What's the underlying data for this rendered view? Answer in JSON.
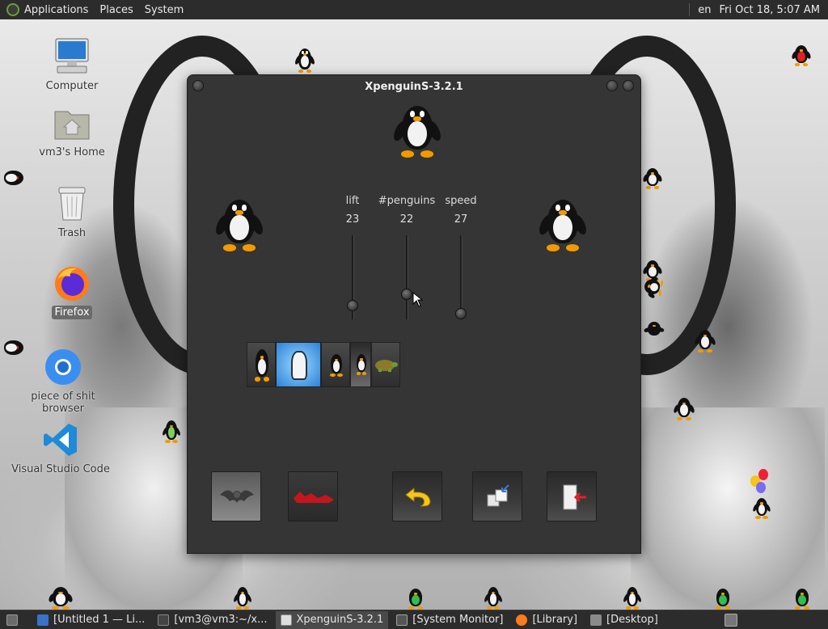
{
  "top_panel": {
    "menus": [
      "Applications",
      "Places",
      "System"
    ],
    "keyboard_layout": "en",
    "clock": "Fri Oct 18,  5:07 AM"
  },
  "desktop_icons": [
    {
      "label": "Computer",
      "icon": "computer-icon"
    },
    {
      "label": "vm3's Home",
      "icon": "home-folder-icon"
    },
    {
      "label": "Trash",
      "icon": "trash-icon"
    },
    {
      "label": "Firefox",
      "icon": "firefox-icon"
    },
    {
      "label": "piece of shit browser",
      "icon": "browser-icon"
    },
    {
      "label": "Visual Studio Code",
      "icon": "vscode-icon"
    }
  ],
  "window": {
    "title": "XpenguinS-3.2.1",
    "sliders": [
      {
        "label": "lift",
        "value": "23"
      },
      {
        "label": "#penguins",
        "value": "22"
      },
      {
        "label": "speed",
        "value": "27"
      }
    ],
    "themes": [
      "penguins-theme",
      "wizard-theme",
      "small-penguin-theme",
      "selected-penguin-theme",
      "turtle-theme"
    ],
    "bottom_buttons": [
      "bat-button",
      "lemming-button",
      "undo-button",
      "windows-button",
      "exit-button"
    ]
  },
  "taskbar": {
    "tasks": [
      {
        "label": "[Untitled 1 — Li...",
        "icon": "writer-icon"
      },
      {
        "label": "[vm3@vm3:~/x...",
        "icon": "terminal-icon"
      },
      {
        "label": "XpenguinS-3.2.1",
        "icon": "window-icon"
      },
      {
        "label": "[System Monitor]",
        "icon": "monitor-icon"
      },
      {
        "label": "[Library]",
        "icon": "firefox-icon"
      },
      {
        "label": "[Desktop]",
        "icon": "folder-icon"
      }
    ]
  },
  "colors": {
    "panel_bg": "#2c2c2c",
    "window_bg": "#353535",
    "penguin_orange": "#f39a00"
  }
}
